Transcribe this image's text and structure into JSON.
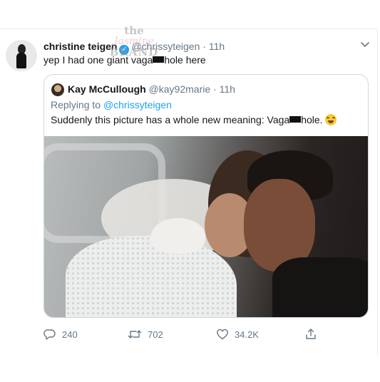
{
  "tweet": {
    "display_name": "christine teigen",
    "handle": "@chrissyteigen",
    "separator": "·",
    "time": "11h",
    "text_before": "yep I had one giant vaga",
    "text_after": "hole here"
  },
  "watermark": {
    "line1": "the",
    "line2": "Jasmine",
    "line3": "BRAND"
  },
  "quoted_tweet": {
    "display_name": "Kay McCullough",
    "handle": "@kay92marie",
    "separator": "·",
    "time": "11h",
    "replying_prefix": "Replying to",
    "replying_to": "@chrissyteigen",
    "text_before": "Suddenly this picture has a whole new meaning: Vaga",
    "text_after": "hole."
  },
  "actions": {
    "reply_count": "240",
    "retweet_count": "702",
    "like_count": "34.2K"
  },
  "icons": {
    "verified": "verified-badge-icon",
    "menu": "chevron-down-icon",
    "reply": "reply-icon",
    "retweet": "retweet-icon",
    "like": "heart-icon",
    "share": "share-icon",
    "emoji": "tears-of-joy-emoji"
  },
  "colors": {
    "verified_blue": "#1da1f2",
    "mention_blue": "#1da1f2",
    "secondary_text": "#657786",
    "border": "#ccd6dd"
  }
}
